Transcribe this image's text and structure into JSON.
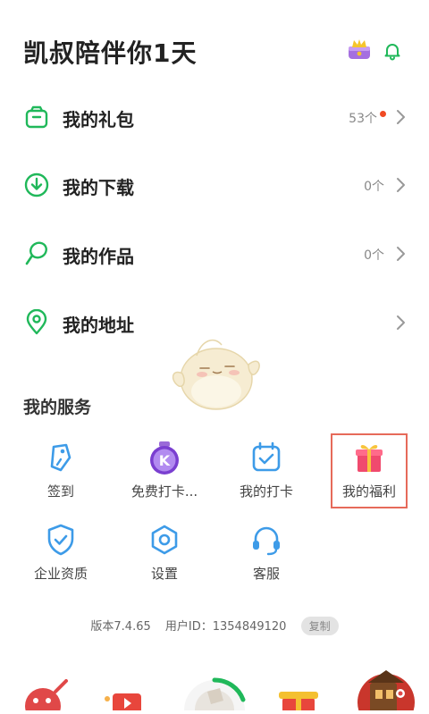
{
  "header": {
    "title": "凯叔陪伴你1天",
    "crown_icon": "crown-gift-icon",
    "bell_icon": "bell-icon"
  },
  "menu": [
    {
      "label": "我的礼包",
      "count": "53个",
      "has_dot": true,
      "icon": "gift-bag-icon"
    },
    {
      "label": "我的下载",
      "count": "0个",
      "icon": "download-icon"
    },
    {
      "label": "我的作品",
      "count": "0个",
      "icon": "microphone-icon"
    },
    {
      "label": "我的地址",
      "count": "",
      "icon": "location-icon"
    }
  ],
  "services": {
    "title": "我的服务",
    "items": [
      {
        "label": "签到",
        "icon": "tag-icon"
      },
      {
        "label": "免费打卡...",
        "icon": "k-badge-icon"
      },
      {
        "label": "我的打卡",
        "icon": "calendar-check-icon"
      },
      {
        "label": "我的福利",
        "icon": "gift-box-icon"
      },
      {
        "label": "企业资质",
        "icon": "shield-check-icon"
      },
      {
        "label": "设置",
        "icon": "settings-icon"
      },
      {
        "label": "客服",
        "icon": "headset-icon"
      }
    ]
  },
  "footer": {
    "version": "版本7.4.65",
    "user_id": "用户ID：1354849120",
    "copy_label": "复制"
  },
  "colors": {
    "accent_green": "#20b85a",
    "service_blue": "#3d9be8",
    "highlight_red": "#e66a5a",
    "badge_red": "#f04a24"
  }
}
